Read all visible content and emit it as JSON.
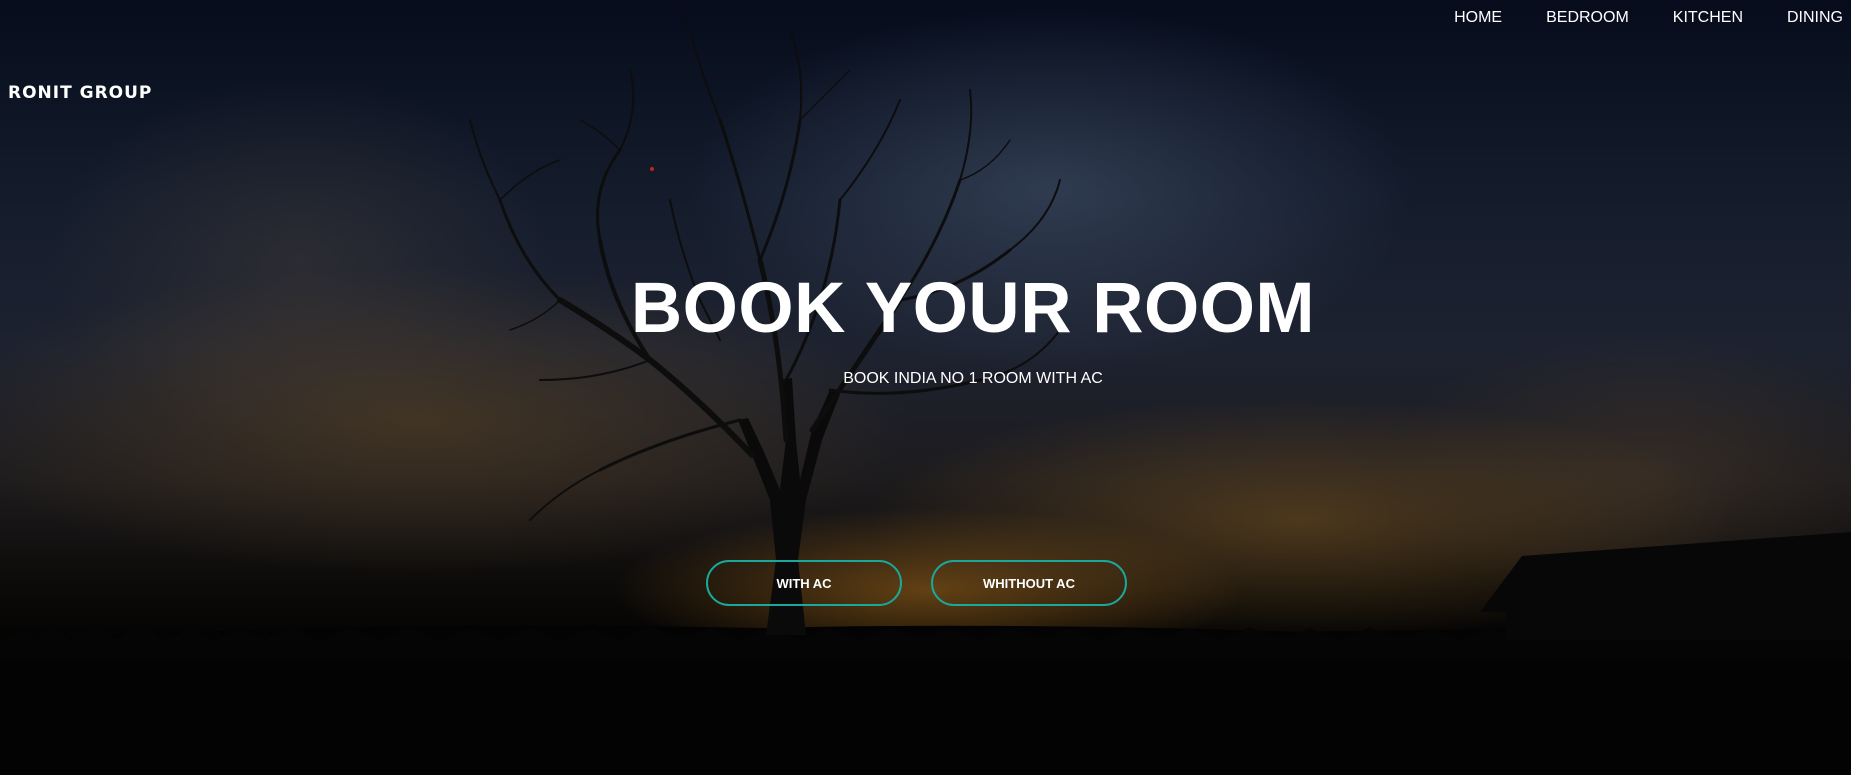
{
  "brand": {
    "logo_text": "RONIT GROUP"
  },
  "nav": {
    "items": [
      {
        "label": "HOME"
      },
      {
        "label": "BEDROOM"
      },
      {
        "label": "KITCHEN"
      },
      {
        "label": "DINING"
      }
    ]
  },
  "hero": {
    "title": "BOOK YOUR ROOM",
    "subtitle": "BOOK INDIA NO 1 ROOM WITH AC",
    "buttons": {
      "with_ac": "WITH AC",
      "without_ac": "WHITHOUT AC"
    },
    "accent_color": "#1aa89a"
  }
}
